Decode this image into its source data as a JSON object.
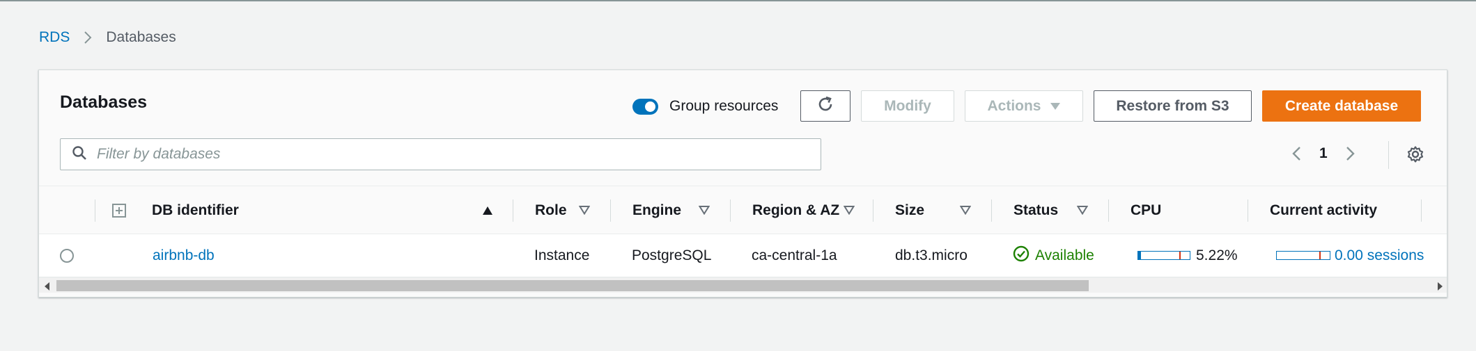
{
  "breadcrumb": {
    "root": "RDS",
    "current": "Databases"
  },
  "panel": {
    "title": "Databases",
    "group_resources": {
      "label": "Group resources",
      "enabled": true
    }
  },
  "toolbar": {
    "refresh_icon": "refresh-icon",
    "modify_label": "Modify",
    "actions_label": "Actions",
    "restore_label": "Restore from S3",
    "create_label": "Create database"
  },
  "search": {
    "placeholder": "Filter by databases",
    "value": ""
  },
  "pagination": {
    "current_page": "1"
  },
  "table": {
    "columns": {
      "db_identifier": "DB identifier",
      "role": "Role",
      "engine": "Engine",
      "region_az": "Region & AZ",
      "size": "Size",
      "status": "Status",
      "cpu": "CPU",
      "current_activity": "Current activity"
    },
    "rows": [
      {
        "db_identifier": "airbnb-db",
        "role": "Instance",
        "engine": "PostgreSQL",
        "region_az": "ca-central-1a",
        "size": "db.t3.micro",
        "status": "Available",
        "cpu": "5.22%",
        "cpu_fraction": 0.0522,
        "current_activity": "0.00 sessions",
        "activity_fraction": 0.0
      }
    ]
  },
  "colors": {
    "link": "#0073bb",
    "primary_button": "#ec7211",
    "status_available": "#1d8102",
    "meter_threshold": "#d13212"
  }
}
